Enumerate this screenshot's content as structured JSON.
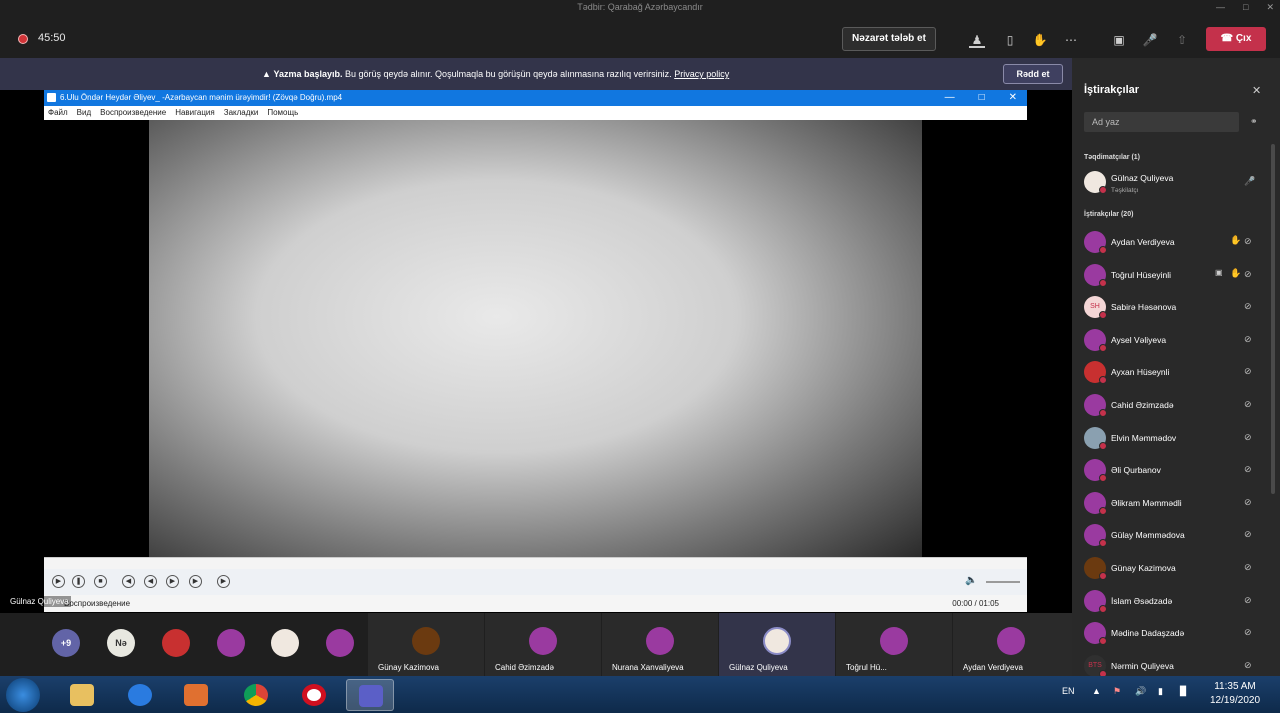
{
  "window": {
    "title": "Tədbir: Qarabağ Azərbaycandır"
  },
  "toolbar": {
    "recording_time": "45:50",
    "request_control_label": "Nəzarət tələb et",
    "leave_label": "Çıx"
  },
  "banner": {
    "title": "Yazma başlayıb.",
    "message": "Bu görüş qeydə alınır. Qoşulmaqla bu görüşün qeydə alınmasına razılıq verirsiniz.",
    "link": "Privacy policy",
    "dismiss_label": "Rədd et"
  },
  "player": {
    "title": "6.Ulu Öndər Heydər Əliyev_ -Azərbaycan mənim ürəyimdir! (Zövqə Doğru).mp4",
    "menu": [
      "Файл",
      "Вид",
      "Воспроизведение",
      "Навигация",
      "Закладки",
      "Помощь"
    ],
    "status": "Воспроизведение",
    "time": "00:00 / 01:05"
  },
  "presenter_caption": "Gülnaz Quliyeva",
  "gallery": {
    "overflow_count": "+9",
    "initials": "Nə",
    "tiles": [
      {
        "name": "Günay Kazimova"
      },
      {
        "name": "Cahid Əzimzadə"
      },
      {
        "name": "Nurana Xanvaliyeva"
      },
      {
        "name": "Gülnaz Quliyeva"
      },
      {
        "name": "Toğrul Hü..."
      },
      {
        "name": "Aydan Verdiyeva"
      }
    ]
  },
  "participants_panel": {
    "title": "İştirakçılar",
    "search_placeholder": "Ad yaz",
    "presenters_header": "Təqdimatçılar (1)",
    "presenter": {
      "name": "Gülnaz Quliyeva",
      "role": "Təşkilatçı",
      "initials": ""
    },
    "attendees_header": "İştirakçılar (20)",
    "attendees": [
      {
        "name": "Aydan Verdiyeva",
        "hand": true,
        "share": false,
        "initials": ""
      },
      {
        "name": "Toğrul Hüseyinli",
        "hand": true,
        "share": true,
        "initials": ""
      },
      {
        "name": "Sabirə Həsənova",
        "hand": false,
        "share": false,
        "initials": "SH"
      },
      {
        "name": "Aysel Vəliyeva",
        "hand": false,
        "share": false,
        "initials": ""
      },
      {
        "name": "Ayxan Hüseynli",
        "hand": false,
        "share": false,
        "initials": ""
      },
      {
        "name": "Cahid Əzimzadə",
        "hand": false,
        "share": false,
        "initials": ""
      },
      {
        "name": "Elvin Məmmədov",
        "hand": false,
        "share": false,
        "initials": ""
      },
      {
        "name": "Əli Qurbanov",
        "hand": false,
        "share": false,
        "initials": ""
      },
      {
        "name": "Əlikram Məmmədli",
        "hand": false,
        "share": false,
        "initials": ""
      },
      {
        "name": "Gülay Məmmədova",
        "hand": false,
        "share": false,
        "initials": ""
      },
      {
        "name": "Günay Kazimova",
        "hand": false,
        "share": false,
        "initials": ""
      },
      {
        "name": "İslam Əsədzadə",
        "hand": false,
        "share": false,
        "initials": ""
      },
      {
        "name": "Mədinə Dadaşzadə",
        "hand": false,
        "share": false,
        "initials": ""
      },
      {
        "name": "Nərmin Quliyeva",
        "hand": false,
        "share": false,
        "initials": "BTS"
      }
    ]
  },
  "taskbar": {
    "language": "EN",
    "time": "11:35 AM",
    "date": "12/19/2020"
  },
  "colors": {
    "leave": "#c4314b",
    "banner": "#33344a",
    "accent": "#1177e0"
  }
}
